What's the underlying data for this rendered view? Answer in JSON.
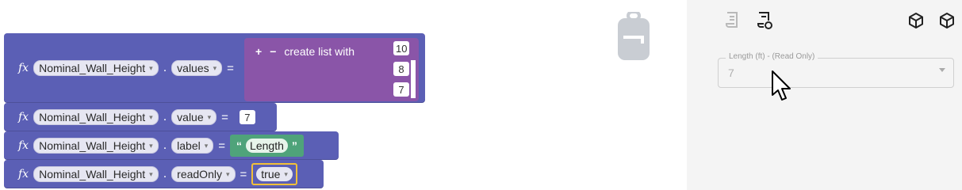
{
  "blocks": [
    {
      "variable": "Nominal_Wall_Height",
      "property": "values",
      "operator": "=",
      "list": {
        "label": "create list with",
        "add_symbol": "+",
        "remove_symbol": "−",
        "items": [
          "10",
          "8",
          "7"
        ]
      }
    },
    {
      "variable": "Nominal_Wall_Height",
      "property": "value",
      "operator": "=",
      "value": "7"
    },
    {
      "variable": "Nominal_Wall_Height",
      "property": "label",
      "operator": "=",
      "value": "Length",
      "open_quote": "“",
      "close_quote": "”"
    },
    {
      "variable": "Nominal_Wall_Height",
      "property": "readOnly",
      "operator": "=",
      "value": "true"
    }
  ],
  "fx_symbol": "fx",
  "dot_symbol": ".",
  "panel": {
    "field": {
      "label": "Length (ft) - (Read Only)",
      "value": "7"
    }
  },
  "colors": {
    "block": "#5b5fb5",
    "list_block": "#8a55a8",
    "string_block": "#4fa37a",
    "selected_outline": "#f2c038",
    "panel_bg": "#f4f4f4"
  },
  "icons": [
    "backpack-icon",
    "script-icon",
    "script-refresh-icon",
    "cube-icon",
    "cube-alt-icon",
    "mouse-cursor-icon"
  ]
}
